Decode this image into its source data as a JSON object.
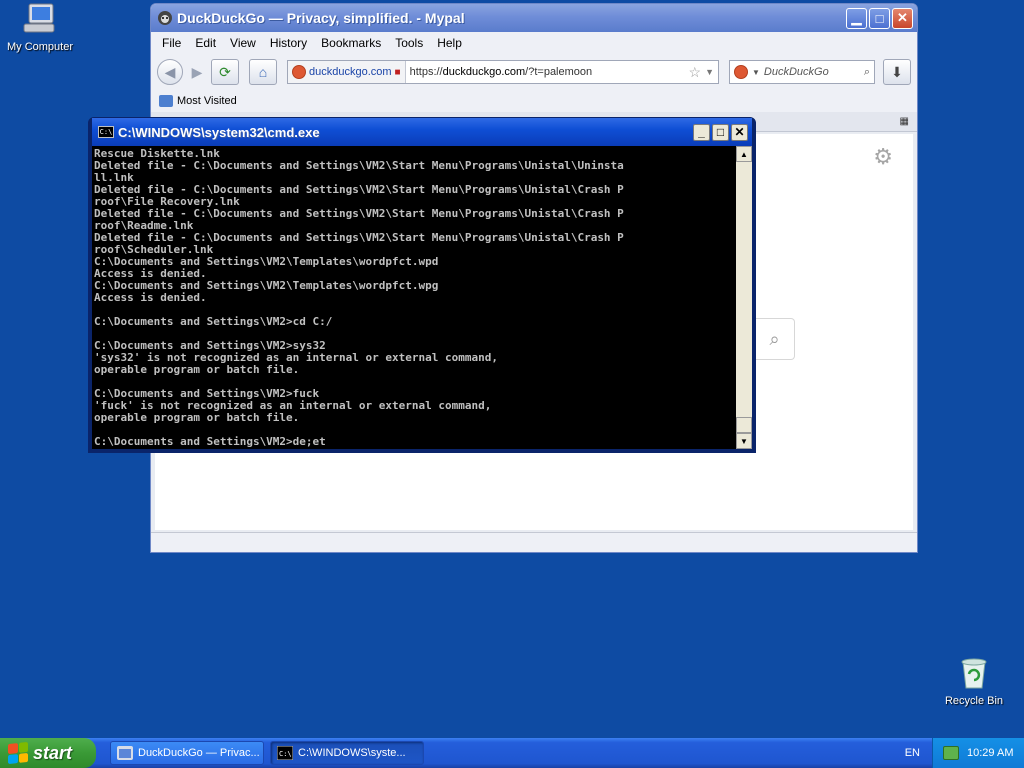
{
  "desktop": {
    "icons": [
      {
        "label": "My Computer"
      },
      {
        "label": "Recycle Bin"
      }
    ]
  },
  "browser": {
    "title": "DuckDuckGo — Privacy, simplified. - Mypal",
    "menu": [
      "File",
      "Edit",
      "View",
      "History",
      "Bookmarks",
      "Tools",
      "Help"
    ],
    "identity_label": "duckduckgo.com",
    "url_prefix": "https://",
    "url_host": "duckduckgo.com",
    "url_path": "/?t=palemoon",
    "search_placeholder": "DuckDuckGo",
    "bookmark_label": "Most Visited"
  },
  "cmd": {
    "title": "C:\\WINDOWS\\system32\\cmd.exe",
    "lines": [
      "Rescue Diskette.lnk",
      "Deleted file - C:\\Documents and Settings\\VM2\\Start Menu\\Programs\\Unistal\\Uninsta",
      "ll.lnk",
      "Deleted file - C:\\Documents and Settings\\VM2\\Start Menu\\Programs\\Unistal\\Crash P",
      "roof\\File Recovery.lnk",
      "Deleted file - C:\\Documents and Settings\\VM2\\Start Menu\\Programs\\Unistal\\Crash P",
      "roof\\Readme.lnk",
      "Deleted file - C:\\Documents and Settings\\VM2\\Start Menu\\Programs\\Unistal\\Crash P",
      "roof\\Scheduler.lnk",
      "C:\\Documents and Settings\\VM2\\Templates\\wordpfct.wpd",
      "Access is denied.",
      "C:\\Documents and Settings\\VM2\\Templates\\wordpfct.wpg",
      "Access is denied.",
      "",
      "C:\\Documents and Settings\\VM2>cd C:/",
      "",
      "C:\\Documents and Settings\\VM2>sys32",
      "'sys32' is not recognized as an internal or external command,",
      "operable program or batch file.",
      "",
      "C:\\Documents and Settings\\VM2>fuck",
      "'fuck' is not recognized as an internal or external command,",
      "operable program or batch file.",
      "",
      "C:\\Documents and Settings\\VM2>de;et"
    ]
  },
  "taskbar": {
    "start_label": "start",
    "tasks": [
      {
        "label": "DuckDuckGo — Privac...",
        "active": false
      },
      {
        "label": "C:\\WINDOWS\\syste...",
        "active": true
      }
    ],
    "language": "EN",
    "clock": "10:29 AM"
  }
}
